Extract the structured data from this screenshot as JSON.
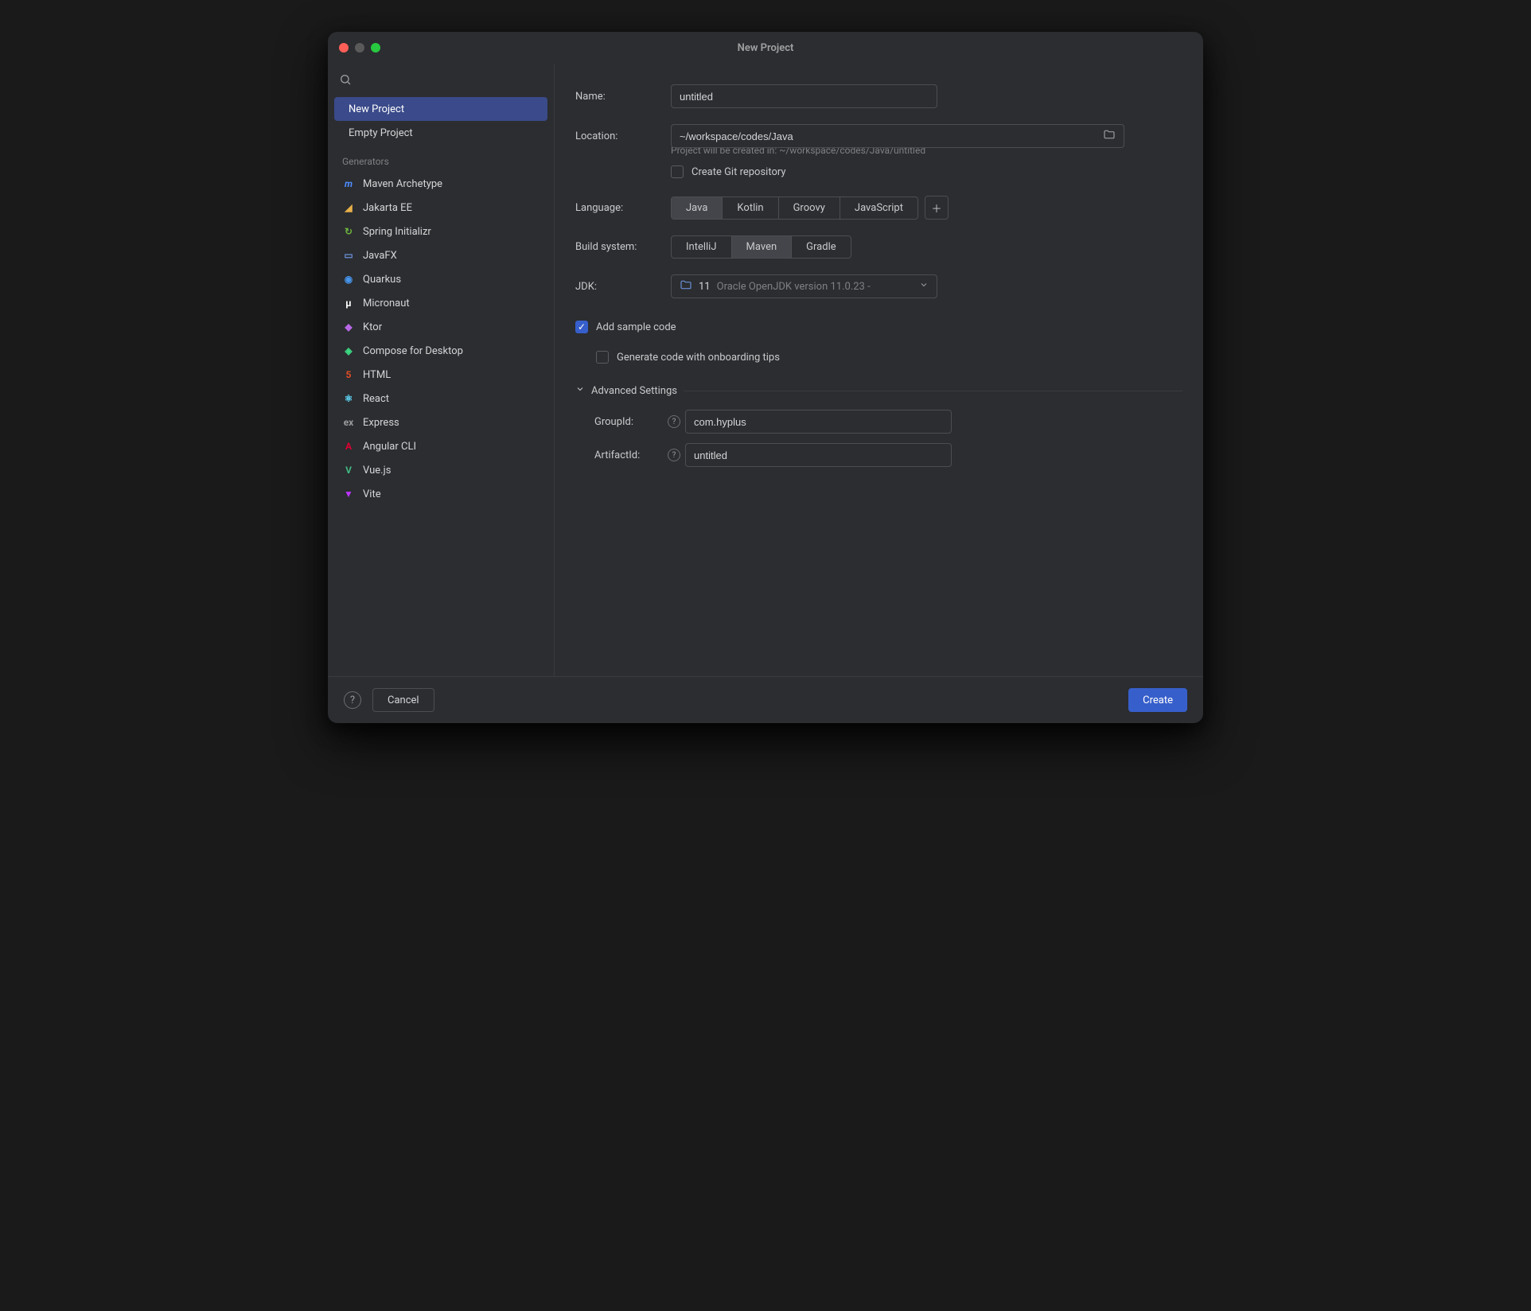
{
  "window": {
    "title": "New Project"
  },
  "sidebar": {
    "items": [
      {
        "label": "New Project"
      },
      {
        "label": "Empty Project"
      }
    ],
    "generators_label": "Generators",
    "generators": [
      {
        "label": "Maven Archetype",
        "icon": "m",
        "color": "#4e8cff"
      },
      {
        "label": "Jakarta EE",
        "icon": "◢",
        "color": "#e8b04a"
      },
      {
        "label": "Spring Initializr",
        "icon": "↻",
        "color": "#6db33f"
      },
      {
        "label": "JavaFX",
        "icon": "▭",
        "color": "#6a8fd6"
      },
      {
        "label": "Quarkus",
        "icon": "◉",
        "color": "#4695eb"
      },
      {
        "label": "Micronaut",
        "icon": "μ",
        "color": "#ffffff"
      },
      {
        "label": "Ktor",
        "icon": "◆",
        "color": "#b868e6"
      },
      {
        "label": "Compose for Desktop",
        "icon": "◈",
        "color": "#3ddc84"
      },
      {
        "label": "HTML",
        "icon": "5",
        "color": "#e44d26"
      },
      {
        "label": "React",
        "icon": "⚛",
        "color": "#61dafb"
      },
      {
        "label": "Express",
        "icon": "ex",
        "color": "#9a9b9d"
      },
      {
        "label": "Angular CLI",
        "icon": "A",
        "color": "#dd0031"
      },
      {
        "label": "Vue.js",
        "icon": "V",
        "color": "#41b883"
      },
      {
        "label": "Vite",
        "icon": "▼",
        "color": "#bd34fe"
      }
    ]
  },
  "form": {
    "name_label": "Name:",
    "name_value": "untitled",
    "location_label": "Location:",
    "location_value": "~/workspace/codes/Java",
    "location_hint": "Project will be created in: ~/workspace/codes/Java/untitled",
    "git_label": "Create Git repository",
    "language_label": "Language:",
    "languages": [
      "Java",
      "Kotlin",
      "Groovy",
      "JavaScript"
    ],
    "language_active": "Java",
    "build_label": "Build system:",
    "builds": [
      "IntelliJ",
      "Maven",
      "Gradle"
    ],
    "build_active": "Maven",
    "jdk_label": "JDK:",
    "jdk_version": "11",
    "jdk_desc": "Oracle OpenJDK version 11.0.23 -",
    "sample_label": "Add sample code",
    "onboard_label": "Generate code with onboarding tips",
    "advanced_label": "Advanced Settings",
    "group_label": "GroupId:",
    "group_value": "com.hyplus",
    "artifact_label": "ArtifactId:",
    "artifact_value": "untitled"
  },
  "footer": {
    "cancel": "Cancel",
    "create": "Create"
  }
}
